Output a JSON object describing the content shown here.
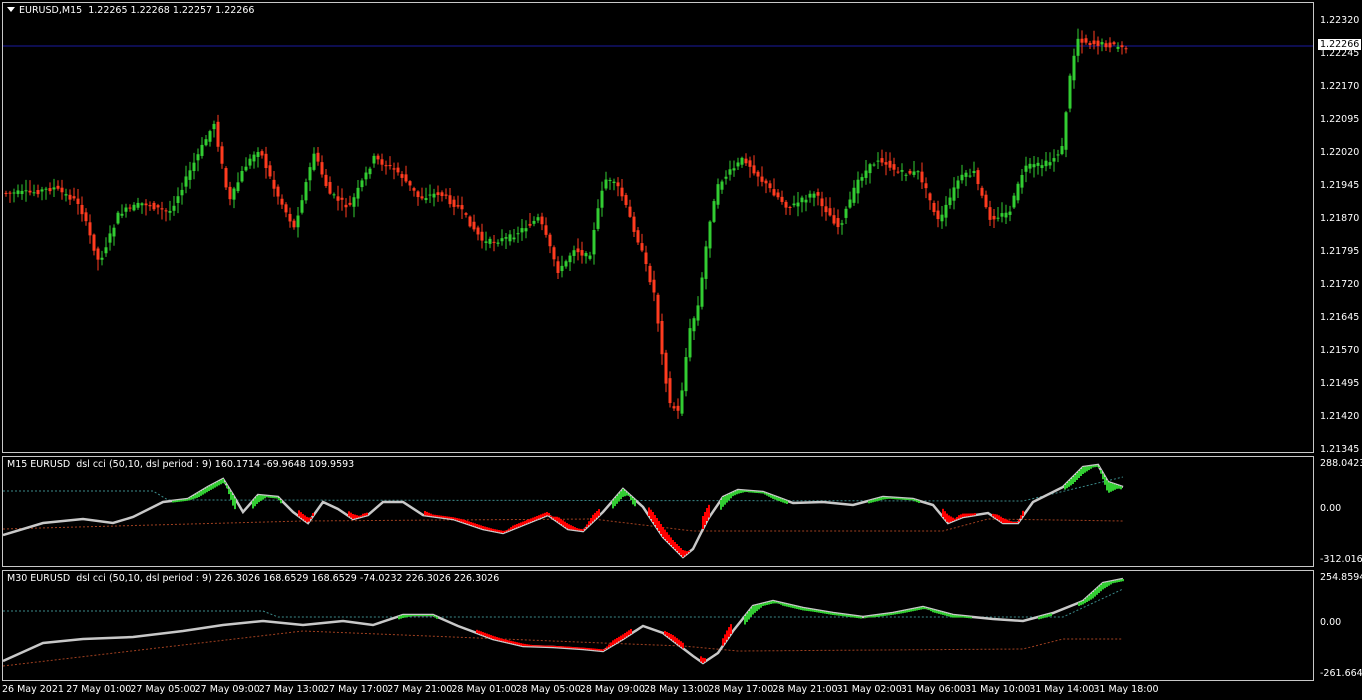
{
  "main": {
    "symbol": "EURUSD,M15",
    "ohlc": "1.22265 1.22268 1.22257 1.22266",
    "current_price": "1.22266",
    "price_ticks": [
      "1.22320",
      "1.22245",
      "1.22170",
      "1.22095",
      "1.22020",
      "1.21945",
      "1.21870",
      "1.21795",
      "1.21720",
      "1.21645",
      "1.21570",
      "1.21495",
      "1.21420",
      "1.21345"
    ]
  },
  "cci1": {
    "title": "M15 EURUSD  dsl cci (50,10, dsl period : 9) 160.1714 -69.9648 109.9593",
    "ticks": [
      "288.0423",
      "0.00",
      "-312.0161"
    ]
  },
  "cci2": {
    "title": "M30 EURUSD  dsl cci (50,10, dsl period : 9) 226.3026 168.6529 168.6529 -74.0232 226.3026 226.3026",
    "ticks": [
      "254.8594",
      "0.00",
      "-261.6642"
    ]
  },
  "time_labels": [
    "26 May 2021",
    "27 May 01:00",
    "27 May 05:00",
    "27 May 09:00",
    "27 May 13:00",
    "27 May 17:00",
    "27 May 21:00",
    "28 May 01:00",
    "28 May 05:00",
    "28 May 09:00",
    "28 May 13:00",
    "28 May 17:00",
    "28 May 21:00",
    "31 May 02:00",
    "31 May 06:00",
    "31 May 10:00",
    "31 May 14:00",
    "31 May 18:00"
  ],
  "colors": {
    "bull": "#32cd32",
    "bear": "#ff3b1f",
    "cci_up": "#32cd32",
    "cci_down": "#ff0000",
    "cci_line": "#c8c8c8",
    "grid_line": "#1a1aa0"
  }
}
